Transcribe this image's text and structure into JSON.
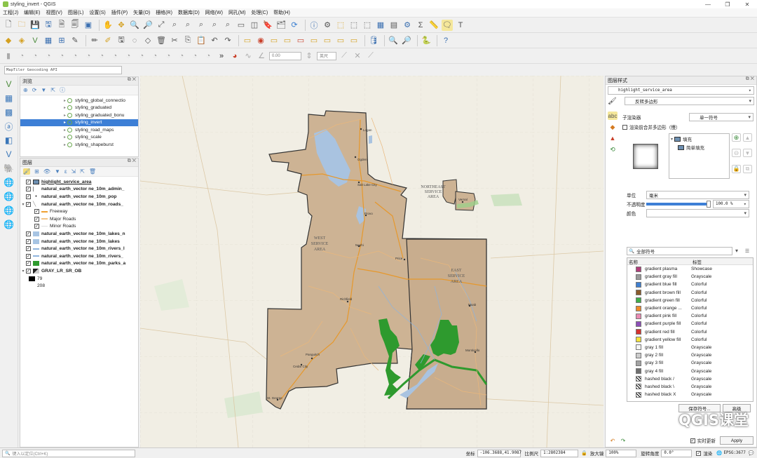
{
  "window": {
    "title": "styling_invert - QGIS",
    "controls": [
      "—",
      "❐",
      "✕"
    ]
  },
  "menu": [
    "工程(J)",
    "编辑(E)",
    "视图(V)",
    "图层(L)",
    "设置(S)",
    "插件(P)",
    "矢量(O)",
    "栅格(R)",
    "数据库(D)",
    "网络(W)",
    "网孔(M)",
    "处理(C)",
    "帮助(H)"
  ],
  "toolbar3": {
    "rotation_value": "0.00",
    "unit": "英尺"
  },
  "geocoder": {
    "placeholder": "MapTiler Geocoding API"
  },
  "browser": {
    "title": "浏览",
    "items": [
      {
        "label": "styling_global_connectio",
        "selected": false
      },
      {
        "label": "styling_graduated",
        "selected": false
      },
      {
        "label": "styling_graduated_bonu",
        "selected": false
      },
      {
        "label": "styling_invert",
        "selected": true
      },
      {
        "label": "styling_road_maps",
        "selected": false
      },
      {
        "label": "styling_scale",
        "selected": false
      },
      {
        "label": "styling_shapeburst",
        "selected": false
      }
    ]
  },
  "layers": {
    "title": "图层",
    "items": [
      {
        "label": "highlight_service_area",
        "bold": true,
        "checked": true,
        "swatch": "#6d8fb1",
        "indent": 0
      },
      {
        "label": "natural_earth_vector ne_10m_admin_",
        "bold": true,
        "checked": true,
        "swatch": "none",
        "indent": 0
      },
      {
        "label": "natural_earth_vector ne_10m_pop",
        "bold": true,
        "checked": true,
        "swatch": "dot",
        "indent": 0
      },
      {
        "label": "natural_earth_vector ne_10m_roads_",
        "bold": true,
        "checked": true,
        "swatch": "line",
        "indent": 0,
        "expanded": true
      },
      {
        "label": "Freeway",
        "bold": false,
        "checked": true,
        "swatch": "#f0a030",
        "indent": 1
      },
      {
        "label": "Major Roads",
        "bold": false,
        "checked": true,
        "swatch": "#f3c58a",
        "indent": 1
      },
      {
        "label": "Minor Roads",
        "bold": false,
        "checked": true,
        "swatch": "#dddddd",
        "indent": 1
      },
      {
        "label": "natural_earth_vector ne_10m_lakes_n",
        "bold": true,
        "checked": true,
        "swatch": "#a7c4e3",
        "indent": 0
      },
      {
        "label": "natural_earth_vector ne_10m_lakes",
        "bold": true,
        "checked": true,
        "swatch": "#a7c4e3",
        "indent": 0
      },
      {
        "label": "natural_earth_vector ne_10m_rivers_l",
        "bold": true,
        "checked": true,
        "swatch": "#8fb4dd",
        "indent": 0
      },
      {
        "label": "natural_earth_vector ne_10m_rivers_",
        "bold": true,
        "checked": true,
        "swatch": "#8fb4dd",
        "indent": 0
      },
      {
        "label": "natural_earth_vector ne_10m_parks_a",
        "bold": true,
        "checked": true,
        "swatch": "#2e9a2e",
        "indent": 0
      },
      {
        "label": "GRAY_LR_SR_OB",
        "bold": true,
        "checked": true,
        "swatch": "raster",
        "indent": 0,
        "expanded": true
      },
      {
        "label": "79",
        "bold": false,
        "checked": false,
        "swatch": "#000000",
        "indent": 1
      },
      {
        "label": "208",
        "bold": false,
        "checked": false,
        "swatch": "none",
        "indent": 1
      }
    ]
  },
  "map": {
    "labels": {
      "west": "WEST\nSERVICE\nAREA",
      "east": "EAST\nSERVICE\nAREA",
      "northeast": "NORTHEAST\nSERVICE\nAREA"
    },
    "cities": [
      "Logan",
      "Ogden",
      "Salt Lake City",
      "Provo",
      "Nephi",
      "Price",
      "Richfield",
      "Moab",
      "Monticello",
      "Panguitch",
      "Cedar City",
      "St. George",
      "Vernal"
    ]
  },
  "style_panel": {
    "title": "图层样式",
    "layer": "highlight_service_area",
    "renderer": "反转多边形",
    "sub_renderer_label": "子渲染器",
    "sub_renderer": "单一符号",
    "merge_checkbox": "渲染前合并多边形（慢）",
    "tree": [
      "填充",
      "简单填充"
    ],
    "unit_label": "单位",
    "unit": "毫米",
    "opacity_label": "不透明度",
    "opacity": "100.0 %",
    "opacity_value": 100,
    "color_label": "颜色",
    "search_placeholder": "全部符号",
    "col_name": "名称",
    "col_tag": "标签",
    "symbols": [
      {
        "name": "gradient  plasma",
        "tag": "Showcase",
        "color": "#b13d7a"
      },
      {
        "name": "gradient  gray fill",
        "tag": "Grayscale",
        "color": "#9a9a9a"
      },
      {
        "name": "gradient blue fill",
        "tag": "Colorful",
        "color": "#3f7fcf"
      },
      {
        "name": "gradient brown fill",
        "tag": "Colorful",
        "color": "#8a5a2b"
      },
      {
        "name": "gradient green fill",
        "tag": "Colorful",
        "color": "#3fae4a"
      },
      {
        "name": "gradient orange ...",
        "tag": "Colorful",
        "color": "#ef8a2a"
      },
      {
        "name": "gradient pink fill",
        "tag": "Colorful",
        "color": "#e98bb3"
      },
      {
        "name": "gradient purple fill",
        "tag": "Colorful",
        "color": "#8d4fb8"
      },
      {
        "name": "gradient red fill",
        "tag": "Colorful",
        "color": "#d4332f"
      },
      {
        "name": "gradient yellow fill",
        "tag": "Colorful",
        "color": "#f3e23c"
      },
      {
        "name": "gray 1 fill",
        "tag": "Grayscale",
        "color": "#f4f4f4"
      },
      {
        "name": "gray 2 fill",
        "tag": "Grayscale",
        "color": "#cccccc"
      },
      {
        "name": "gray 3 fill",
        "tag": "Grayscale",
        "color": "#a3a3a3"
      },
      {
        "name": "gray 4 fill",
        "tag": "Grayscale",
        "color": "#6e6e6e"
      },
      {
        "name": "hashed black /",
        "tag": "Grayscale",
        "color": "hatch"
      },
      {
        "name": "hashed black \\",
        "tag": "Grayscale",
        "color": "hatch"
      },
      {
        "name": "hashed black X",
        "tag": "Grayscale",
        "color": "hatch"
      }
    ],
    "save_symbol": "保存符号...",
    "advanced": "高级",
    "live_update": "实时更新",
    "apply": "Apply"
  },
  "statusbar": {
    "locate_placeholder": "键入以定位(Ctrl+K)",
    "coord_label": "坐标",
    "coord": "-106.3688,41.9087",
    "scale_label": "比例尺",
    "scale": "1:2802384",
    "magnifier_label": "放大镜",
    "magnifier": "100%",
    "rotation_label": "旋转角度",
    "rotation": "0.0°",
    "render_label": "渲染",
    "crs": "EPSG:3677"
  },
  "watermark": "QGIS课堂"
}
